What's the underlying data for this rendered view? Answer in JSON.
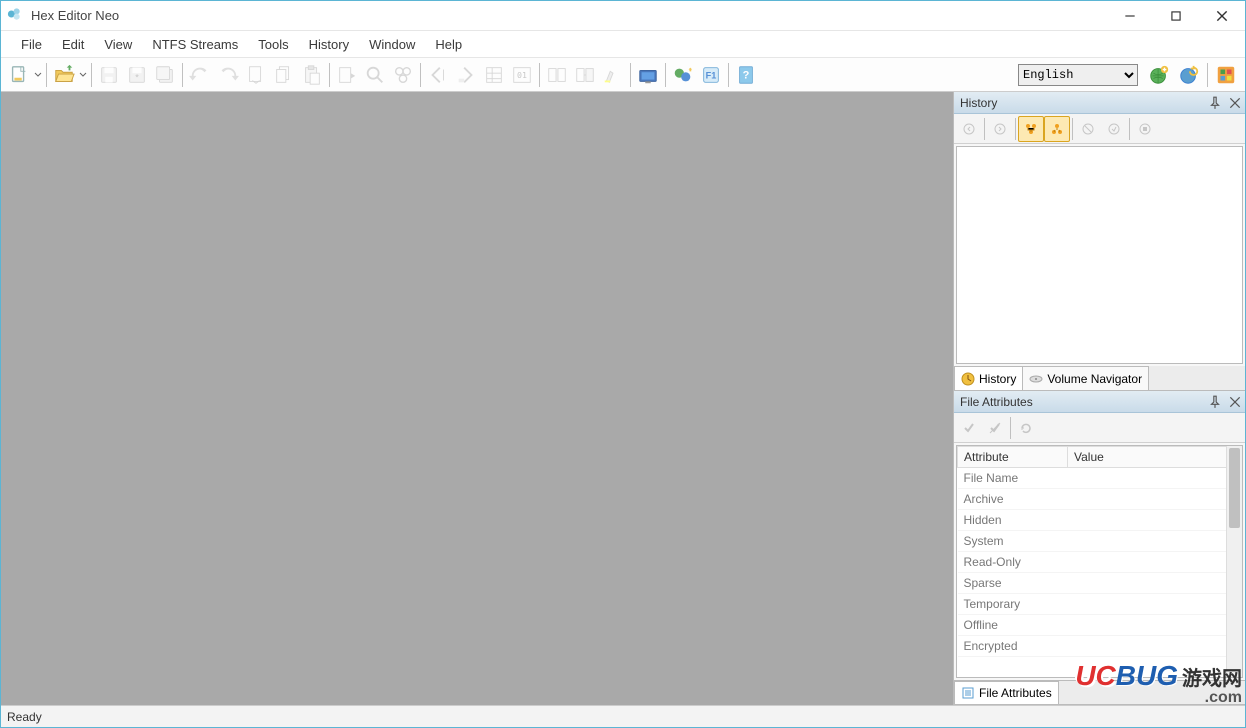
{
  "app": {
    "title": "Hex Editor Neo",
    "icon": "hex-editor-logo"
  },
  "menu": [
    "File",
    "Edit",
    "View",
    "NTFS Streams",
    "Tools",
    "History",
    "Window",
    "Help"
  ],
  "toolbar": {
    "language": "English"
  },
  "panels": {
    "history": {
      "title": "History",
      "tabs": [
        {
          "label": "History",
          "active": true,
          "icon": "clock-icon"
        },
        {
          "label": "Volume Navigator",
          "active": false,
          "icon": "disk-icon"
        }
      ]
    },
    "file_attributes": {
      "title": "File Attributes",
      "columns": [
        "Attribute",
        "Value"
      ],
      "rows": [
        {
          "attr": "File Name",
          "value": ""
        },
        {
          "attr": "Archive",
          "value": ""
        },
        {
          "attr": "Hidden",
          "value": ""
        },
        {
          "attr": "System",
          "value": ""
        },
        {
          "attr": "Read-Only",
          "value": ""
        },
        {
          "attr": "Sparse",
          "value": ""
        },
        {
          "attr": "Temporary",
          "value": ""
        },
        {
          "attr": "Offline",
          "value": ""
        },
        {
          "attr": "Encrypted",
          "value": ""
        }
      ],
      "bottom_tab": "File Attributes"
    }
  },
  "status": "Ready",
  "watermark": {
    "brand1": "UC",
    "brand2": "BUG",
    "cn": "游戏网",
    "dotcom": ".com"
  }
}
